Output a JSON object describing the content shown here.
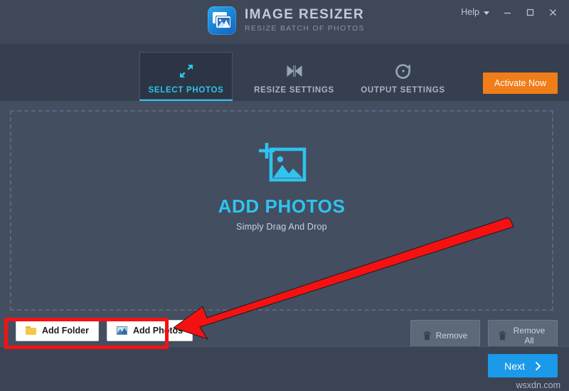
{
  "app": {
    "title": "IMAGE RESIZER",
    "subtitle": "RESIZE BATCH OF PHOTOS",
    "logo_icon": "image-resizer-app-icon",
    "accent_cyan": "#2fc3ee",
    "accent_orange": "#f07d18",
    "accent_blue": "#1a9ae8",
    "panel_bg": "#434e61",
    "header_bg": "#3e4859",
    "tabbar_bg": "#353f4e",
    "annotation_red": "#f51111"
  },
  "titlebar": {
    "help_label": "Help",
    "help_chevron_icon": "chevron-down-icon",
    "minimize_icon": "minimize-icon",
    "maximize_icon": "maximize-icon",
    "close_icon": "close-icon"
  },
  "tabs": [
    {
      "label": "SELECT PHOTOS",
      "icon": "resize-arrows-icon",
      "active": true
    },
    {
      "label": "RESIZE SETTINGS",
      "icon": "hourglass-bowtie-icon",
      "active": false
    },
    {
      "label": "OUTPUT SETTINGS",
      "icon": "refresh-circle-icon",
      "active": false
    }
  ],
  "activate": {
    "label": "Activate Now"
  },
  "dropzone": {
    "icon": "add-photo-frame-icon",
    "title": "ADD PHOTOS",
    "subtitle": "Simply Drag And Drop"
  },
  "actions": {
    "add_folder": {
      "label": "Add Folder",
      "icon": "folder-icon"
    },
    "add_photos": {
      "label": "Add Photos",
      "icon": "photo-icon"
    },
    "remove": {
      "label": "Remove",
      "icon": "trash-icon"
    },
    "remove_all": {
      "label": "Remove All",
      "icon": "trash-icon"
    }
  },
  "footer": {
    "next_label": "Next",
    "next_chevron_icon": "chevron-right-icon",
    "watermark": "wsxdn.com"
  },
  "annotations": {
    "highlight_box": "red-rectangle-around-add-buttons",
    "arrow": "red-arrow-pointing-left-to-add-buttons"
  }
}
